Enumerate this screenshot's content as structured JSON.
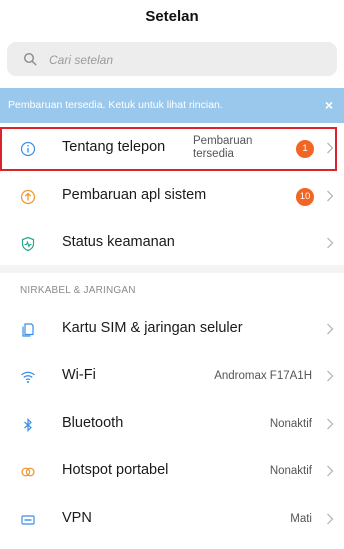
{
  "header": {
    "title": "Setelan"
  },
  "search": {
    "placeholder": "Cari setelan"
  },
  "banner": {
    "message": "Pembaruan tersedia. Ketuk untuk lihat rincian.",
    "close_label": "×",
    "color": "#9ac8ec"
  },
  "top_items": [
    {
      "label": "Tentang telepon",
      "status_line1": "Pembaruan",
      "status_line2": "tersedia",
      "badge": "1",
      "icon": "info-icon"
    },
    {
      "label": "Pembaruan apl sistem",
      "badge": "10",
      "icon": "upload-arrow-icon"
    },
    {
      "label": "Status keamanan",
      "icon": "shield-icon"
    }
  ],
  "section_network": {
    "header": "NIRKABEL & JARINGAN",
    "items": [
      {
        "label": "Kartu SIM & jaringan seluler",
        "value": "",
        "icon": "sim-card-icon"
      },
      {
        "label": "Wi-Fi",
        "value": "Andromax F17A1H",
        "icon": "wifi-icon"
      },
      {
        "label": "Bluetooth",
        "value": "Nonaktif",
        "icon": "bluetooth-icon"
      },
      {
        "label": "Hotspot portabel",
        "value": "Nonaktif",
        "icon": "hotspot-icon"
      },
      {
        "label": "VPN",
        "value": "Mati",
        "icon": "vpn-icon"
      }
    ]
  },
  "colors": {
    "badge": "#f26522",
    "highlight_border": "#d8242a",
    "icon_blue": "#3a8ee6",
    "icon_orange": "#f0942c",
    "icon_teal": "#28a58a"
  }
}
